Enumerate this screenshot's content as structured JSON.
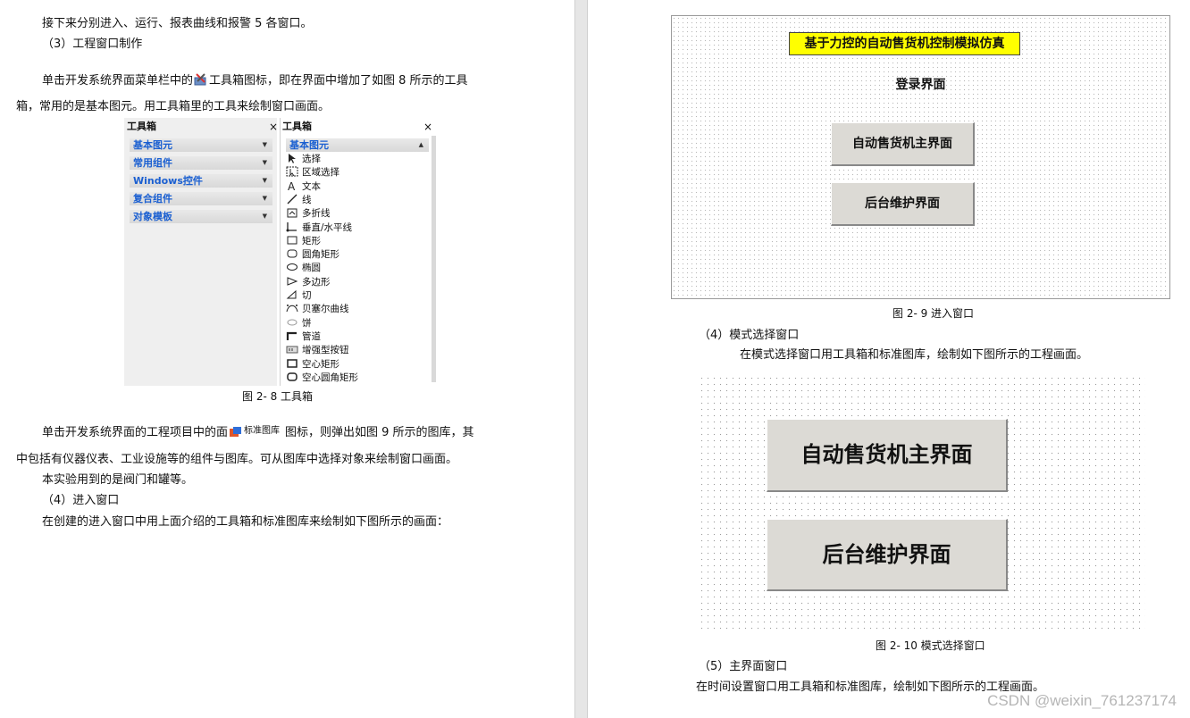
{
  "left_page": {
    "para1": "接下来分别进入、运行、报表曲线和报警 5 各窗口。",
    "heading3": "（3）工程窗口制作",
    "para2_before": "单击开发系统界面菜单栏中的",
    "para2_after": "工具箱图标，即在界面中增加了如图 8 所示的工具",
    "para2_line2": "箱，常用的是基本图元。用工具箱里的工具来绘制窗口画面。",
    "toolbox": {
      "left_title": "工具箱",
      "right_title": "工具箱",
      "close_glyph": "×",
      "categories": [
        "基本图元",
        "常用组件",
        "Windows控件",
        "复合组件",
        "对象模板"
      ],
      "right_category": "基本图元",
      "items": [
        "选择",
        "区域选择",
        "文本",
        "线",
        "多折线",
        "垂直/水平线",
        "矩形",
        "圆角矩形",
        "椭圆",
        "多边形",
        "切",
        "贝塞尔曲线",
        "饼",
        "管道",
        "增强型按钮",
        "空心矩形",
        "空心圆角矩形"
      ]
    },
    "caption_fig8": "图 2- 8  工具箱",
    "para3_before": "单击开发系统界面的工程项目中的面",
    "para3_icon_label": "标准图库",
    "para3_after": "图标，则弹出如图 9 所示的图库，其",
    "para3_line2": "中包括有仪器仪表、工业设施等的组件与图库。可从图库中选择对象来绘制窗口画面。",
    "para4": "本实验用到的是阀门和罐等。",
    "heading4": "（4）进入窗口",
    "para5": "在创建的进入窗口中用上面介绍的工具箱和标准图库来绘制如下图所示的画面："
  },
  "right_page": {
    "fig9": {
      "title": "基于力控的自动售货机控制模拟仿真",
      "login_label": "登录界面",
      "btn_main": "自动售货机主界面",
      "btn_backend": "后台维护界面"
    },
    "caption_fig9": "图 2- 9  进入窗口",
    "heading_mode": "（4）模式选择窗口",
    "para_mode": "在模式选择窗口用工具箱和标准图库，绘制如下图所示的工程画面。",
    "fig10": {
      "btn_main": "自动售货机主界面",
      "btn_backend": "后台维护界面"
    },
    "caption_fig10": "图 2- 10  模式选择窗口",
    "heading5": "（5）主界面窗口",
    "para_main": "在时间设置窗口用工具箱和标准图库，绘制如下图所示的工程画面。"
  },
  "watermark": "CSDN @weixin_761237174"
}
